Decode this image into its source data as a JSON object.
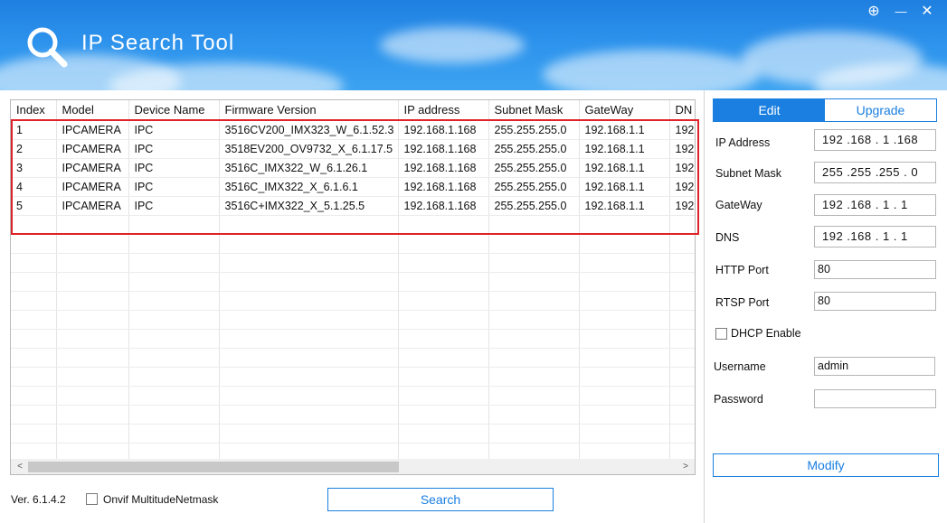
{
  "window": {
    "title": "IP Search Tool",
    "controls": {
      "plus": "⊕",
      "minimize": "—",
      "close": "✕"
    }
  },
  "table": {
    "columns": [
      "Index",
      "Model",
      "Device Name",
      "Firmware Version",
      "IP address",
      "Subnet Mask",
      "GateWay",
      "DN"
    ],
    "rows": [
      [
        "1",
        "IPCAMERA",
        "IPC",
        "3516CV200_IMX323_W_6.1.52.3",
        "192.168.1.168",
        "255.255.255.0",
        "192.168.1.1",
        "192"
      ],
      [
        "2",
        "IPCAMERA",
        "IPC",
        "3518EV200_OV9732_X_6.1.17.5",
        "192.168.1.168",
        "255.255.255.0",
        "192.168.1.1",
        "192"
      ],
      [
        "3",
        "IPCAMERA",
        "IPC",
        "3516C_IMX322_W_6.1.26.1",
        "192.168.1.168",
        "255.255.255.0",
        "192.168.1.1",
        "192"
      ],
      [
        "4",
        "IPCAMERA",
        "IPC",
        "3516C_IMX322_X_6.1.6.1",
        "192.168.1.168",
        "255.255.255.0",
        "192.168.1.1",
        "192"
      ],
      [
        "5",
        "IPCAMERA",
        "IPC",
        "3516C+IMX322_X_5.1.25.5",
        "192.168.1.168",
        "255.255.255.0",
        "192.168.1.1",
        "192"
      ]
    ],
    "scroll": {
      "left_arrow": "<",
      "right_arrow": ">"
    }
  },
  "panel": {
    "tabs": {
      "edit": "Edit",
      "upgrade": "Upgrade"
    },
    "ip_address": {
      "label": "IP Address",
      "value": "192 .168 .  1  .168"
    },
    "subnet_mask": {
      "label": "Subnet Mask",
      "value": "255 .255 .255 .  0"
    },
    "gateway": {
      "label": "GateWay",
      "value": "192 .168 .  1  .  1"
    },
    "dns": {
      "label": "DNS",
      "value": "192 .168 .  1  .  1"
    },
    "http_port": {
      "label": "HTTP Port",
      "value": "80"
    },
    "rtsp_port": {
      "label": "RTSP Port",
      "value": "80"
    },
    "dhcp": {
      "label": "DHCP Enable",
      "checked": false
    },
    "username": {
      "label": "Username",
      "value": "admin"
    },
    "password": {
      "label": "Password",
      "value": ""
    },
    "modify_label": "Modify"
  },
  "footer": {
    "version": "Ver. 6.1.4.2",
    "onvif_label": "Onvif MultitudeNetmask",
    "search_label": "Search"
  },
  "colors": {
    "accent": "#1a7fe0",
    "highlight": "#e0222a",
    "header": "#2c92ec"
  }
}
